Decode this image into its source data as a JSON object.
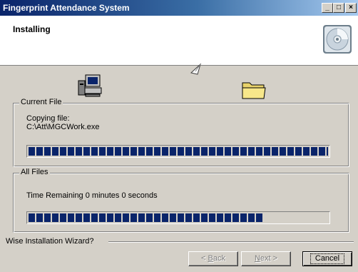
{
  "window": {
    "title": "Fingerprint Attendance System"
  },
  "header": {
    "title": "Installing"
  },
  "current_file": {
    "legend": "Current File",
    "action": "Copying file:",
    "path": "C:\\Att\\MGCWork.exe",
    "progress": 1.0
  },
  "all_files": {
    "legend": "All Files",
    "time_remaining": "Time Remaining 0 minutes 0 seconds",
    "progress": 0.78
  },
  "footer": {
    "brand": "Wise Installation Wizard?"
  },
  "buttons": {
    "back": {
      "pre": "< ",
      "accel": "B",
      "rest": "ack"
    },
    "next": {
      "accel": "N",
      "rest": "ext >"
    },
    "cancel": "Cancel"
  },
  "titlebar_buttons": {
    "minimize": "_",
    "maximize": "□",
    "close": "×"
  },
  "icons": [
    "computer-icon",
    "paper-plane-icon",
    "folder-icon",
    "cd-icon"
  ]
}
